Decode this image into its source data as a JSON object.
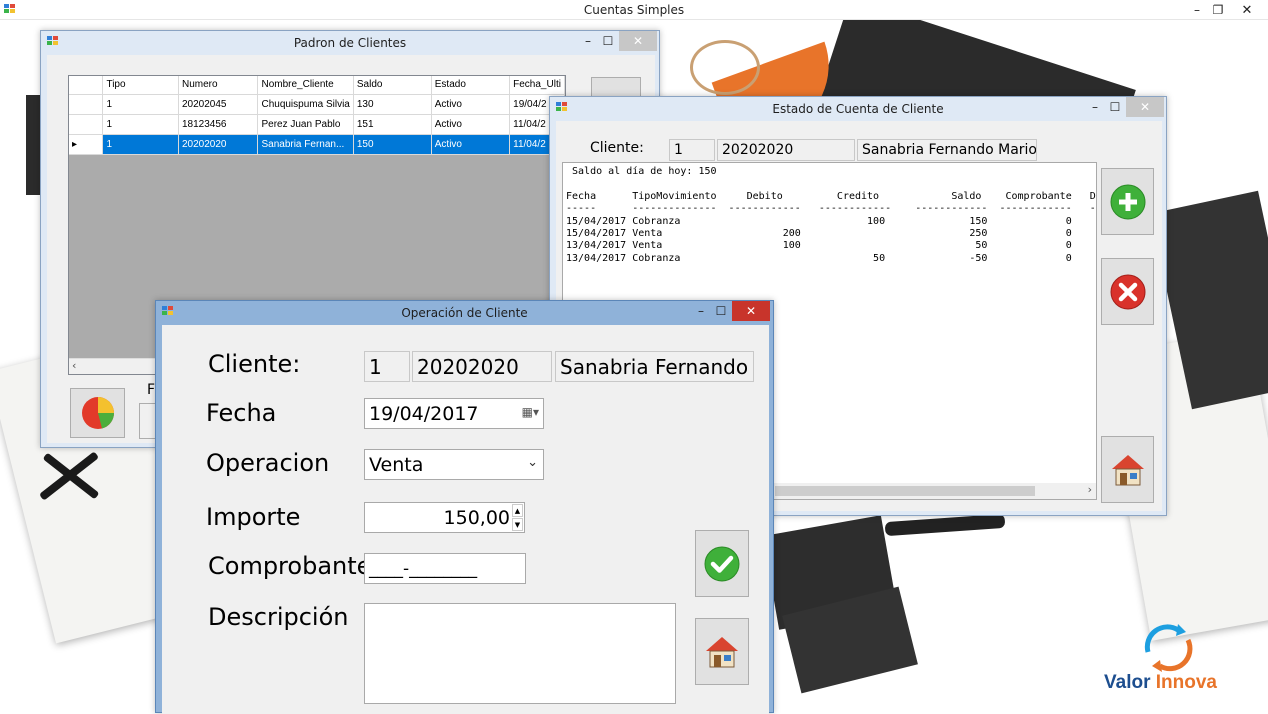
{
  "app": {
    "title": "Cuentas Simples"
  },
  "padron": {
    "title": "Padron de Clientes",
    "columns": [
      "",
      "Tipo",
      "Numero",
      "Nombre_Cliente",
      "Saldo",
      "Estado",
      "Fecha_Ulti"
    ],
    "rows": [
      {
        "marker": "",
        "tipo": "1",
        "numero": "20202045",
        "nombre": "Chuquispuma Silvia",
        "saldo": "130",
        "estado": "Activo",
        "fecha": "19/04/2"
      },
      {
        "marker": "",
        "tipo": "1",
        "numero": "18123456",
        "nombre": "Perez Juan Pablo",
        "saldo": "151",
        "estado": "Activo",
        "fecha": "11/04/2"
      },
      {
        "marker": "▸",
        "tipo": "1",
        "numero": "20202020",
        "nombre": "Sanabria Fernan...",
        "saldo": "150",
        "estado": "Activo",
        "fecha": "11/04/2"
      }
    ],
    "hidden_label": "F"
  },
  "estado": {
    "title": "Estado de Cuenta de Cliente",
    "cliente_label": "Cliente:",
    "cliente_tipo": "1",
    "cliente_numero": "20202020",
    "cliente_nombre": "Sanabria Fernando Mario",
    "statement": [
      " Saldo al día de hoy: 150",
      "",
      "Fecha      TipoMovimiento     Debito         Credito            Saldo    Comprobante   Deta",
      "-----      --------------  ------------   ------------    ------------  ------------   ----",
      "15/04/2017 Cobranza                               100              150             0",
      "15/04/2017 Venta                    200                            250             0",
      "13/04/2017 Venta                    100                             50             0",
      "13/04/2017 Cobranza                                50              -50             0"
    ]
  },
  "operacion": {
    "title": "Operación de Cliente",
    "cliente_label": "Cliente:",
    "cliente_tipo": "1",
    "cliente_numero": "20202020",
    "cliente_nombre": "Sanabria Fernando M",
    "fecha_label": "Fecha",
    "fecha_value": "19/04/2017",
    "operacion_label": "Operacion",
    "operacion_value": "Venta",
    "importe_label": "Importe",
    "importe_value": "150,00",
    "comprobante_label": "Comprobante",
    "comprobante_value": "____-________",
    "descripcion_label": "Descripción",
    "descripcion_value": ""
  },
  "brand": {
    "name_part1": "Valor",
    "name_part2": "Innova"
  },
  "colors": {
    "selection": "#0078d7",
    "titlebar": "#dfe9f5",
    "active_titlebar": "#7aa7d6",
    "brand_blue": "#1d4e8f",
    "brand_orange": "#e8742a"
  }
}
